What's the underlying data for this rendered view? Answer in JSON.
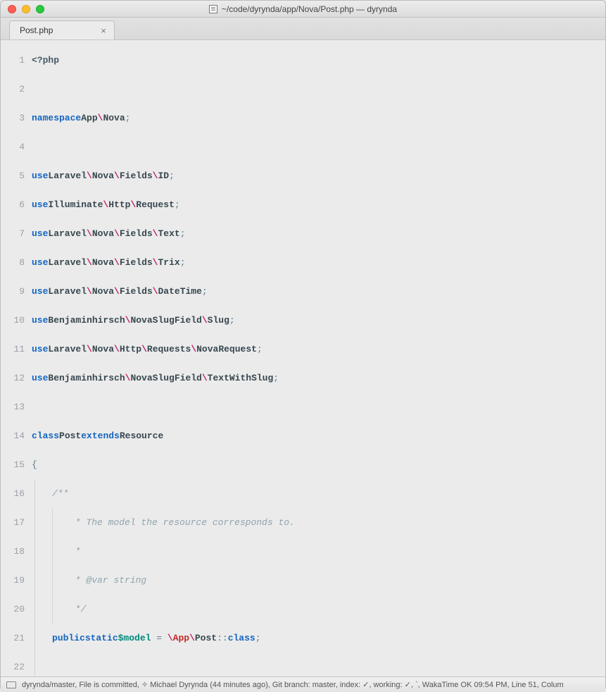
{
  "window": {
    "title": "~/code/dyrynda/app/Nova/Post.php — dyrynda"
  },
  "tab": {
    "label": "Post.php",
    "close": "×"
  },
  "lines": {
    "l1_open": "<?php",
    "l3_kw": "namespace",
    "l3_ns": "App",
    "l3_sep": "\\",
    "l3_ns2": "Nova",
    "l3_semi": ";",
    "l5_kw": "use",
    "l5_p1": "Laravel",
    "l5_p2": "Nova",
    "l5_p3": "Fields",
    "l5_p4": "ID",
    "l6_kw": "use",
    "l6_p1": "Illuminate",
    "l6_p2": "Http",
    "l6_p3": "Request",
    "l7_kw": "use",
    "l7_p1": "Laravel",
    "l7_p2": "Nova",
    "l7_p3": "Fields",
    "l7_p4": "Text",
    "l8_kw": "use",
    "l8_p1": "Laravel",
    "l8_p2": "Nova",
    "l8_p3": "Fields",
    "l8_p4": "Trix",
    "l9_kw": "use",
    "l9_p1": "Laravel",
    "l9_p2": "Nova",
    "l9_p3": "Fields",
    "l9_p4": "DateTime",
    "l10_kw": "use",
    "l10_p1": "Benjaminhirsch",
    "l10_p2": "NovaSlugField",
    "l10_p3": "Slug",
    "l11_kw": "use",
    "l11_p1": "Laravel",
    "l11_p2": "Nova",
    "l11_p3": "Http",
    "l11_p4": "Requests",
    "l11_p5": "NovaRequest",
    "l12_kw": "use",
    "l12_p1": "Benjaminhirsch",
    "l12_p2": "NovaSlugField",
    "l12_p3": "TextWithSlug",
    "l14_kw1": "class",
    "l14_cls": "Post",
    "l14_kw2": "extends",
    "l14_par": "Resource",
    "l15_brace": "{",
    "l16_c": "/**",
    "l17_c": " * The model the resource corresponds to.",
    "l18_c": " *",
    "l19_c": " * @var string",
    "l20_c": " */",
    "l21_pub": "public",
    "l21_sta": "static",
    "l21_var": "$model",
    "l21_eq": " = ",
    "l21_slash": "\\",
    "l21_app": "App",
    "l21_post": "Post",
    "l21_dc": "::",
    "l21_class": "class",
    "l21_semi": ";",
    "semi": ";",
    "bs": "\\"
  },
  "gutter": [
    "1",
    "2",
    "3",
    "4",
    "5",
    "6",
    "7",
    "8",
    "9",
    "10",
    "11",
    "12",
    "13",
    "14",
    "15",
    "16",
    "17",
    "18",
    "19",
    "20",
    "21",
    "22"
  ],
  "status": {
    "project": "dyrynda/master",
    "commit": ", File is committed, ",
    "spark": "✧ ",
    "author": "Michael Dyrynda (44 minutes ago)",
    "git": ", Git branch: master, index: ",
    "check1": "✓",
    "working": ", working: ",
    "check2": "✓",
    "tick": ", `, ",
    "waka": "WakaTime OK 09:54 PM, Line 51, Colum"
  }
}
